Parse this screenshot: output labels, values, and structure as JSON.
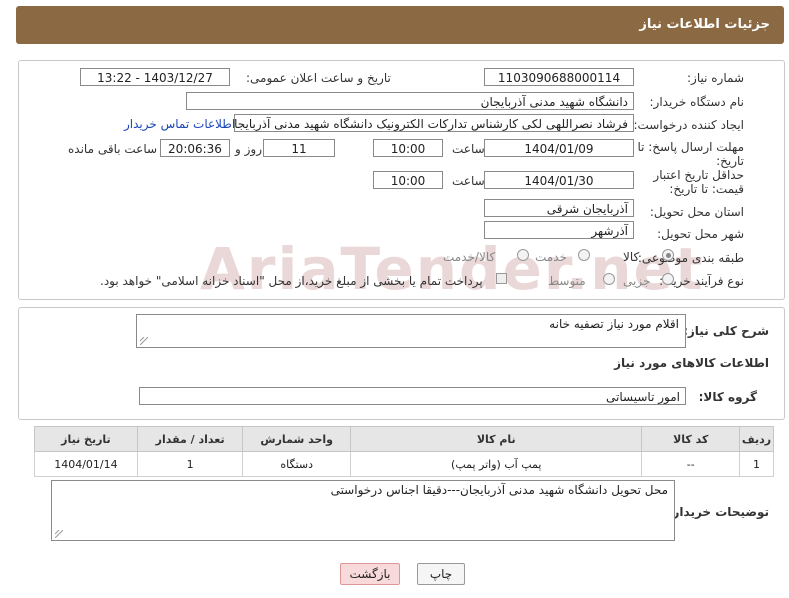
{
  "header": {
    "title": "جزئیات اطلاعات نیاز"
  },
  "form": {
    "need_number": {
      "label": "شماره نیاز:",
      "value": "1103090688000114"
    },
    "announce_datetime": {
      "label": "تاریخ و ساعت اعلان عمومی:",
      "value": "1403/12/27 - 13:22"
    },
    "buyer_org": {
      "label": "نام دستگاه خریدار:",
      "value": "دانشگاه شهید مدنی آذربایجان"
    },
    "creator": {
      "label": "ایجاد کننده درخواست:",
      "value": "فرشاد نصراللهی لکی کارشناس تدارکات الکترونیک دانشگاه شهید مدنی آذربایجان",
      "contact_link": "اطلاعات تماس خریدار"
    },
    "response_deadline": {
      "label": "مهلت ارسال پاسخ: تا تاریخ:",
      "date": "1404/01/09",
      "time_label": "ساعت",
      "time": "10:00",
      "days": "11",
      "days_label": "روز و",
      "remaining": "20:06:36",
      "remaining_label": "ساعت باقی مانده"
    },
    "price_validity": {
      "label": "حداقل تاریخ اعتبار قیمت: تا تاریخ:",
      "date": "1404/01/30",
      "time_label": "ساعت",
      "time": "10:00"
    },
    "province": {
      "label": "استان محل تحویل:",
      "value": "آذربایجان شرقی"
    },
    "city": {
      "label": "شهر محل تحویل:",
      "value": "آذرشهر"
    },
    "category": {
      "label": "طبقه بندی موضوعی:",
      "options": [
        "کالا",
        "خدمت",
        "کالا/خدمت"
      ],
      "selected": "کالا"
    },
    "process": {
      "label": "نوع فرآیند خرید :",
      "options": [
        "جزیی",
        "متوسط"
      ],
      "payment_note": "پرداخت تمام یا بخشی از مبلغ خرید،از محل \"اسناد خزانه اسلامی\" خواهد بود."
    }
  },
  "description": {
    "label": "شرح کلی نیاز:",
    "value": "اقلام مورد نیاز تصفیه خانه"
  },
  "goods_section": {
    "title": "اطلاعات کالاهای مورد نیاز"
  },
  "goods_group": {
    "label": "گروه کالا:",
    "value": "امور تاسیساتی"
  },
  "table": {
    "headers": [
      "ردیف",
      "کد کالا",
      "نام کالا",
      "واحد شمارش",
      "تعداد / مقدار",
      "تاریخ نیاز"
    ],
    "rows": [
      [
        "1",
        "--",
        "پمپ آب (واتر پمپ)",
        "دستگاه",
        "1",
        "1404/01/14"
      ]
    ]
  },
  "buyer_notes": {
    "label": "توضیحات خریدار:",
    "value": "محل تحویل دانشگاه شهید مدنی آذربایجان---دقیقا اجناس درخواستی"
  },
  "buttons": {
    "print": "چاپ",
    "back": "بازگشت"
  },
  "watermark": {
    "text": "AriaTender.net"
  },
  "colors": {
    "header": "#8b6a43",
    "link": "#1a47b8",
    "back_button": "#f8dada"
  }
}
